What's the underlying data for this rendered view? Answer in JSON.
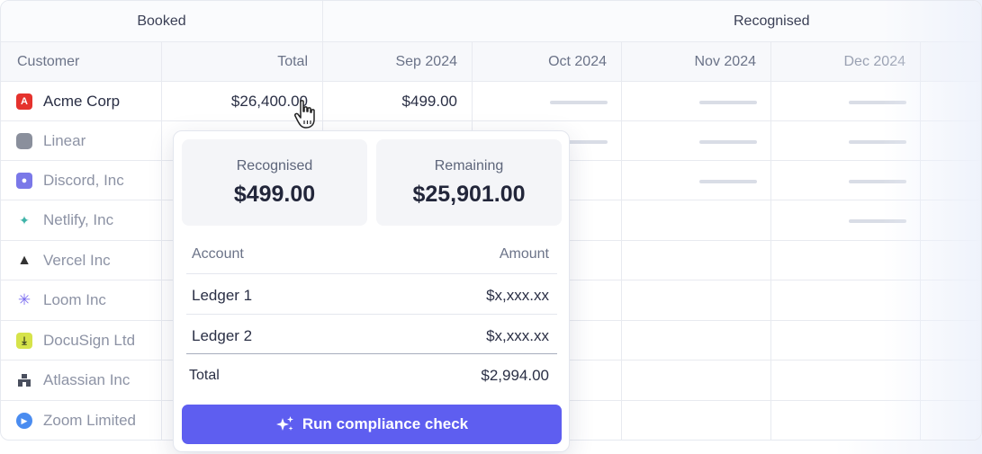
{
  "groups": {
    "booked": "Booked",
    "recognised": "Recognised"
  },
  "columns": {
    "customer": "Customer",
    "total": "Total",
    "months": [
      "Sep 2024",
      "Oct 2024",
      "Nov 2024",
      "Dec 2024"
    ]
  },
  "rows": [
    {
      "name": "Acme Corp",
      "total": "$26,400.00",
      "sep": "$499.00",
      "logo_color": "#e5322d"
    },
    {
      "name": "Linear",
      "logo_color": "#8a8f9c"
    },
    {
      "name": "Discord, Inc",
      "logo_color": "#7a78e8"
    },
    {
      "name": "Netlify, Inc",
      "logo_color": "#3fb3a8"
    },
    {
      "name": "Vercel Inc",
      "logo_color": "#333333"
    },
    {
      "name": "Loom Inc",
      "logo_color": "#7a6cf0"
    },
    {
      "name": "DocuSign Ltd",
      "logo_color": "#d6e34a"
    },
    {
      "name": "Atlassian Inc",
      "logo_color": "#4a4f5e"
    },
    {
      "name": "Zoom Limited",
      "logo_color": "#4a8cf0"
    }
  ],
  "popover": {
    "recognised_label": "Recognised",
    "recognised_value": "$499.00",
    "remaining_label": "Remaining",
    "remaining_value": "$25,901.00",
    "account_header": "Account",
    "amount_header": "Amount",
    "ledgers": [
      {
        "name": "Ledger 1",
        "amount": "$x,xxx.xx"
      },
      {
        "name": "Ledger 2",
        "amount": "$x,xxx.xx"
      }
    ],
    "total_label": "Total",
    "total_value": "$2,994.00",
    "button_label": "Run compliance check"
  },
  "accent_color": "#5e5ef0"
}
